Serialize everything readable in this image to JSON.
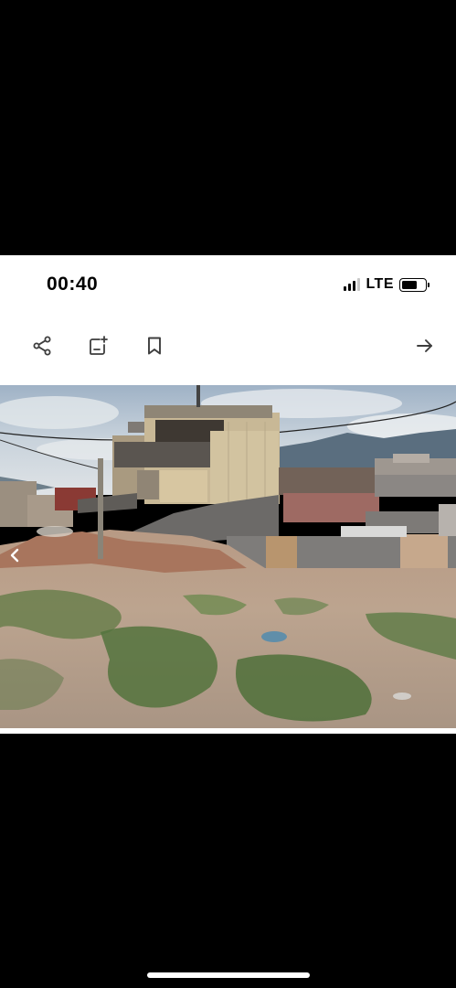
{
  "status_bar": {
    "time": "00:40",
    "network": "LTE",
    "signal_bars_active": 3,
    "signal_bars_total": 4,
    "battery_level": 0.7
  },
  "toolbar": {
    "icons": [
      "share-icon",
      "add-note-icon",
      "bookmark-icon",
      "forward-arrow-icon"
    ]
  },
  "gallery": {
    "nav_icon": "chevron-left-icon"
  },
  "colors": {
    "background": "#000000",
    "card": "#ffffff",
    "icon": "#3d3d3d"
  }
}
